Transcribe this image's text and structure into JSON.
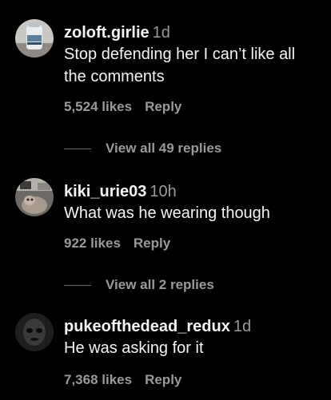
{
  "comments": [
    {
      "username": "zoloft.girlie",
      "time": "1d",
      "text_lines": [
        "Stop defending her I can’t like all",
        "the comments"
      ],
      "likes": "5,524 likes",
      "reply_label": "Reply",
      "view_replies": "View all 49 replies",
      "avatar_icon": "avatar-photo-bottle"
    },
    {
      "username": "kiki_urie03",
      "time": "10h",
      "text_lines": [
        "What was he wearing though"
      ],
      "likes": "922 likes",
      "reply_label": "Reply",
      "view_replies": "View all 2 replies",
      "avatar_icon": "avatar-photo-dog"
    },
    {
      "username": "pukeofthedead_redux",
      "time": "1d",
      "text_lines": [
        "He was asking for it"
      ],
      "likes": "7,368 likes",
      "reply_label": "Reply",
      "avatar_icon": "avatar-photo-dark-figure"
    }
  ],
  "colors": {
    "background": "#000000",
    "primary_text": "#f5f5f5",
    "secondary_text": "#9a9a9a"
  }
}
